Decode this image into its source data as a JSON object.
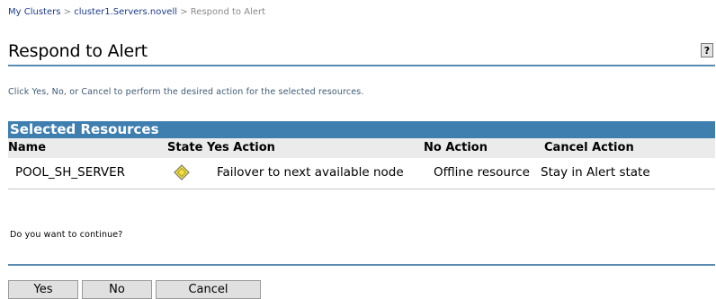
{
  "breadcrumb": {
    "items": [
      "My Clusters",
      "cluster1.Servers.novell"
    ],
    "separator": ">",
    "current": "Respond to Alert"
  },
  "page": {
    "title": "Respond to Alert",
    "help_label": "?",
    "instructions": "Click Yes, No, or Cancel to perform the desired action for the selected resources."
  },
  "resources": {
    "section_title": "Selected Resources",
    "columns": [
      "Name",
      "State",
      "Yes Action",
      "No Action",
      "Cancel Action"
    ],
    "rows": [
      {
        "name": "POOL_SH_SERVER",
        "state_icon": "alert-diamond-icon",
        "yes_action": "Failover to next available node",
        "no_action": "Offline resource",
        "cancel_action": "Stay in Alert state"
      }
    ]
  },
  "prompt": {
    "question": "Do you want to continue?"
  },
  "buttons": {
    "yes": "Yes",
    "no": "No",
    "cancel": "Cancel"
  },
  "colors": {
    "link": "#1c3b8c",
    "section_bar": "#3f7fb0",
    "rule": "#5a8ab0",
    "alert_icon": "#f0e040"
  }
}
